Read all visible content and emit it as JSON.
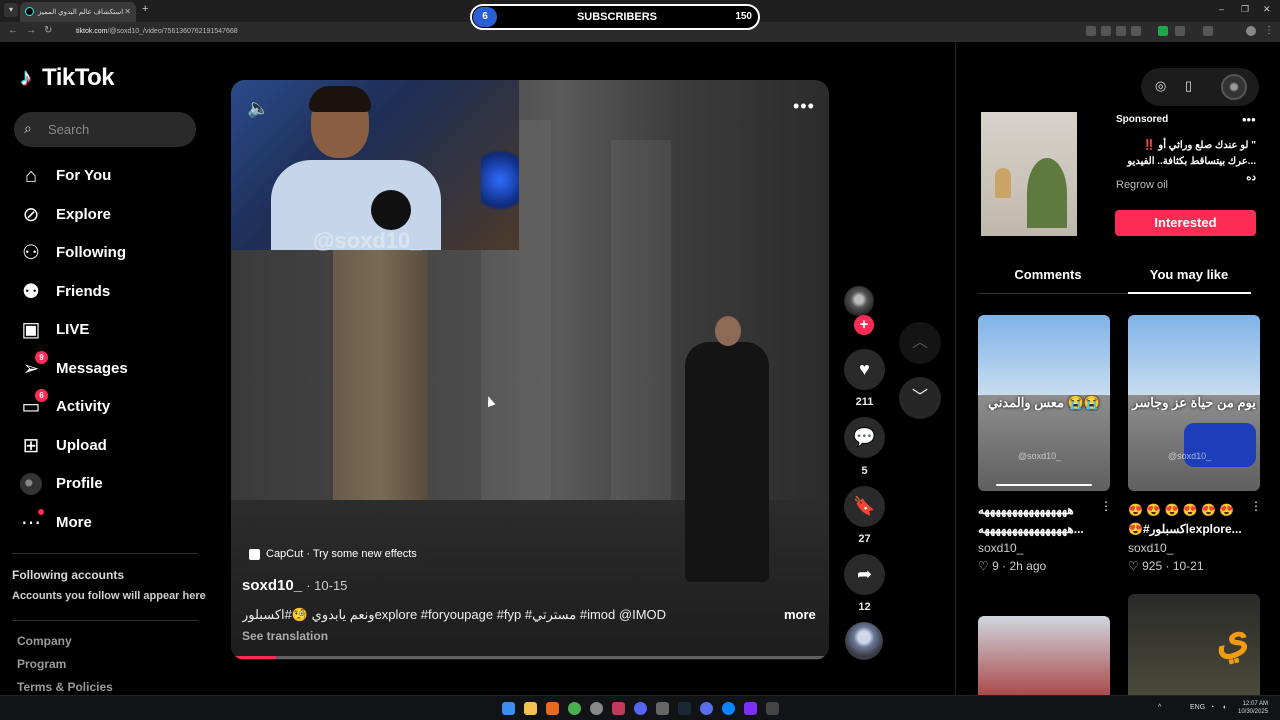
{
  "browser": {
    "tab_title": "استكشاف عالم البدوي المميز",
    "url_host": "tiktok.com",
    "url_path": "/@soxd10_/video/7561360762191547668",
    "window_controls": [
      "–",
      "❐",
      "✕"
    ]
  },
  "subscriber_counter": {
    "left_count": "6",
    "label": "SUBSCRIBERS",
    "right_count": "150",
    "accent_color": "#2a5fd8"
  },
  "sidebar": {
    "logo_text": "TikTok",
    "search_placeholder": "Search",
    "nav": [
      {
        "label": "For You",
        "icon": "home-icon"
      },
      {
        "label": "Explore",
        "icon": "compass-icon"
      },
      {
        "label": "Following",
        "icon": "following-icon"
      },
      {
        "label": "Friends",
        "icon": "friends-icon"
      },
      {
        "label": "LIVE",
        "icon": "live-icon"
      },
      {
        "label": "Messages",
        "icon": "messages-icon",
        "badge": "9"
      },
      {
        "label": "Activity",
        "icon": "activity-icon",
        "badge": "6"
      },
      {
        "label": "Upload",
        "icon": "upload-icon"
      },
      {
        "label": "Profile",
        "icon": "avatar"
      },
      {
        "label": "More",
        "icon": "more-icon"
      }
    ],
    "following_title": "Following accounts",
    "following_subtitle": "Accounts you follow will appear here",
    "footer_links": [
      "Company",
      "Program",
      "Terms & Policies"
    ]
  },
  "video": {
    "webcam_watermark": "@soxd10_",
    "capcut_text": "CapCut · Try some new effects",
    "author": "soxd10_",
    "date": "· 10-15",
    "caption": "ونعم يابدوي 🧐#اكسبلورexplore #foryoupage #fyp #مسترتي #imod @IMOD",
    "more_label": "more",
    "see_translation": "See translation",
    "progress": 0.07,
    "accent_color": "#fe2c55"
  },
  "actions": {
    "follow_plus": "+",
    "likes": "211",
    "comments": "5",
    "saves": "27",
    "shares": "12"
  },
  "right_panel": {
    "sponsored_label": "Sponsored",
    "ad_text_line1": "\" لو عندك صلع وراثي أو ‼️",
    "ad_text_line2": "...عرك بيتساقط بكثافة.. الفيديو ده",
    "ad_brand": "Regrow oil",
    "interested_label": "Interested",
    "tabs": [
      "Comments",
      "You may like"
    ],
    "active_tab": "You may like",
    "videos": [
      {
        "overlay": "😭😭 معس والمدني",
        "title_line1": "ههههههههههههههههه",
        "title_line2": "ههههههههههههههههه...",
        "user": "soxd10_",
        "likes": "9",
        "time": "2h ago",
        "watermark": "@soxd10_"
      },
      {
        "overlay": "يوم من حياة عز وجاسر",
        "title_line1": "😍 😍 😍 😍 😍 😍",
        "title_line2": "😍#اكسبلورexplore...",
        "user": "soxd10_",
        "likes": "925",
        "time": "10-21",
        "watermark": "@soxd10_"
      }
    ]
  },
  "taskbar": {
    "lang": "ENG",
    "time": "12:07 AM",
    "date": "10/30/2025"
  }
}
